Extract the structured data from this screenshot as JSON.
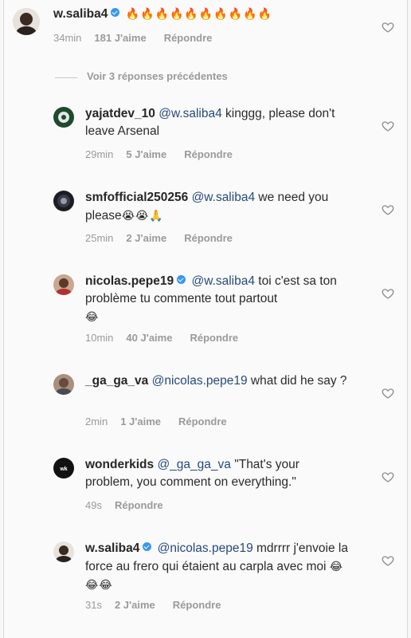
{
  "comments": [
    {
      "username": "w.saliba4",
      "verified": true,
      "mention": "",
      "text": "🔥🔥🔥🔥🔥🔥🔥🔥🔥🔥",
      "time": "34min",
      "likes": "181 J'aime",
      "reply": "Répondre"
    },
    {
      "username": "yajatdev_10",
      "verified": false,
      "mention": "@w.saliba4",
      "text": "kinggg, please don't leave Arsenal",
      "time": "29min",
      "likes": "5 J'aime",
      "reply": "Répondre"
    },
    {
      "username": "smfofficial250256",
      "verified": false,
      "mention": "@w.saliba4",
      "text": "we need you please",
      "emoji": "😭😭🙏",
      "time": "25min",
      "likes": "2 J'aime",
      "reply": "Répondre"
    },
    {
      "username": "nicolas.pepe19",
      "verified": true,
      "mention": "@w.saliba4",
      "text": "toi c'est sa ton problème tu commente tout partout",
      "emoji": "😂",
      "time": "10min",
      "likes": "40 J'aime",
      "reply": "Répondre"
    },
    {
      "username": "_ga_ga_va",
      "verified": false,
      "mention": "@nicolas.pepe19",
      "text": "what did he say ?",
      "time": "2min",
      "likes": "1 J'aime",
      "reply": "Répondre"
    },
    {
      "username": "wonderkids",
      "verified": false,
      "mention": "@_ga_ga_va",
      "text": "\"That's your problem, you comment on everything.\"",
      "time": "49s",
      "likes": "",
      "reply": "Répondre"
    },
    {
      "username": "w.saliba4",
      "verified": true,
      "mention": "@nicolas.pepe19",
      "text": "mdrrrr j'envoie la force au frero qui étaient au carpla avec moi",
      "emoji": "😂😂😂",
      "time": "31s",
      "likes": "2 J'aime",
      "reply": "Répondre"
    }
  ],
  "view_replies": "Voir 3 réponses précédentes",
  "icons": {
    "like": "heart-outline-icon",
    "verified": "verified-badge-icon"
  },
  "colors": {
    "verified": "#3897f0",
    "mention": "#274a7a",
    "meta": "#9a9a9a"
  }
}
